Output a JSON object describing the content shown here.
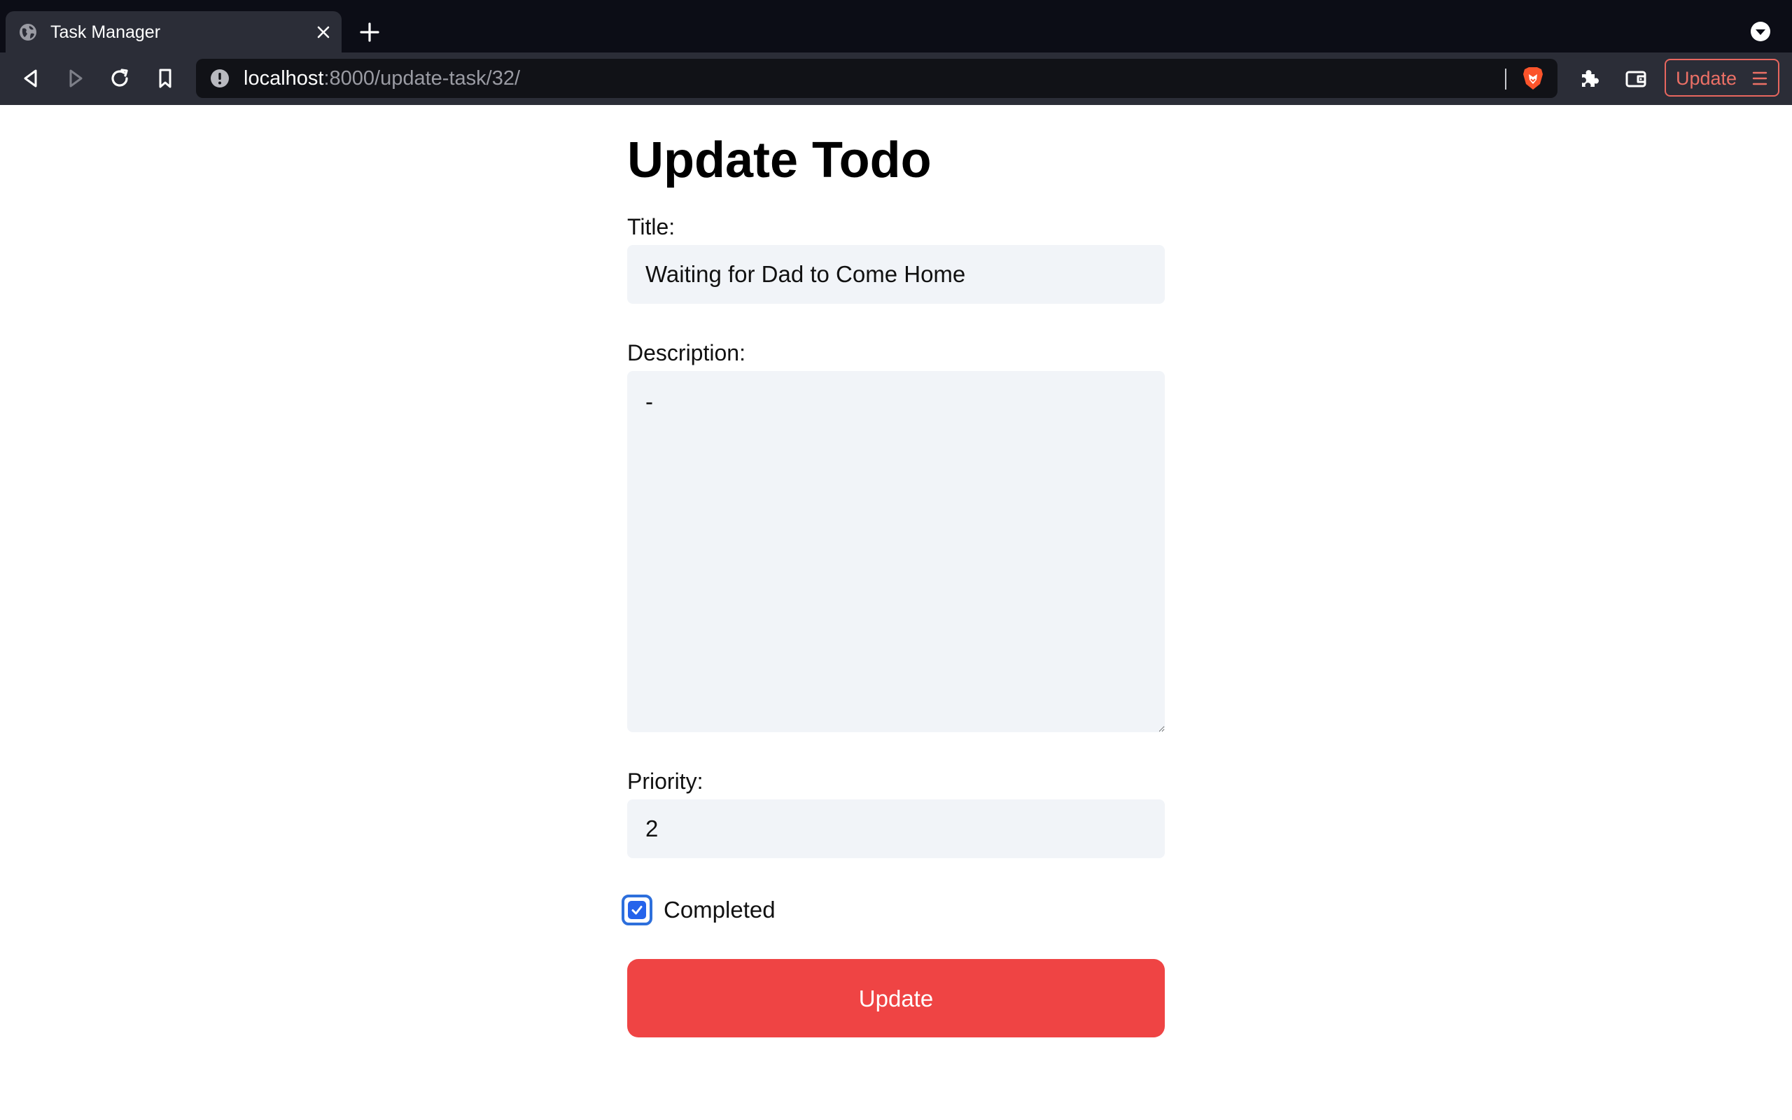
{
  "browser": {
    "tab_title": "Task Manager",
    "url_host": "localhost",
    "url_path": ":8000/update-task/32/",
    "update_button_label": "Update",
    "accent_color": "#e8675f"
  },
  "form": {
    "heading": "Update Todo",
    "title_label": "Title:",
    "title_value": "Waiting for Dad to Come Home",
    "description_label": "Description:",
    "description_value": "-",
    "priority_label": "Priority:",
    "priority_value": "2",
    "completed_label": "Completed",
    "completed_checked": true,
    "submit_label": "Update",
    "submit_color": "#ef4444"
  }
}
